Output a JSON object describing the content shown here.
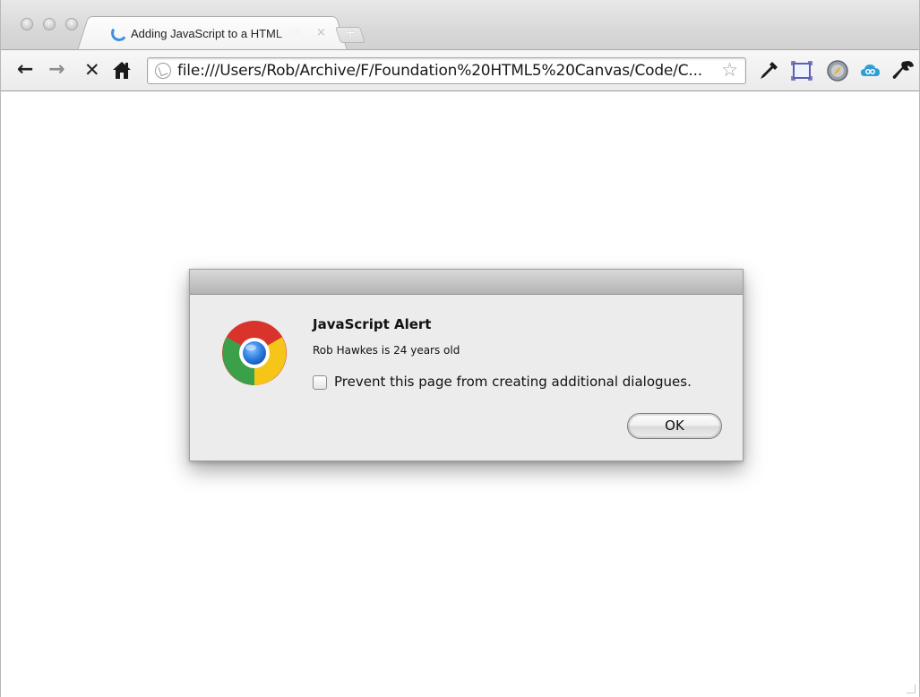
{
  "browser": {
    "tab": {
      "title": "Adding JavaScript to a HTML",
      "close_glyph": "×"
    },
    "new_tab_glyph": "+",
    "nav": {
      "back_glyph": "←",
      "forward_glyph": "→",
      "stop_glyph": "✕",
      "home_glyph": "🏠"
    },
    "address_bar": {
      "url": "file:///Users/Rob/Archive/F/Foundation%20HTML5%20Canvas/Code/C...",
      "bookmark_glyph": "☆"
    },
    "toolbar_icons": [
      "eyedropper-icon",
      "screen-capture-icon",
      "compass-icon",
      "cloud-icon",
      "wrench-icon"
    ]
  },
  "dialog": {
    "title": "JavaScript Alert",
    "message": "Rob Hawkes is 24 years old",
    "checkbox_label": "Prevent this page from creating additional dialogues.",
    "checkbox_checked": false,
    "ok_label": "OK"
  },
  "colors": {
    "spinner": "#3d8fe0",
    "chrome_red": "#d9342b",
    "chrome_green": "#3aa04a",
    "chrome_yellow": "#f5c518",
    "chrome_blue": "#2b7de0"
  }
}
